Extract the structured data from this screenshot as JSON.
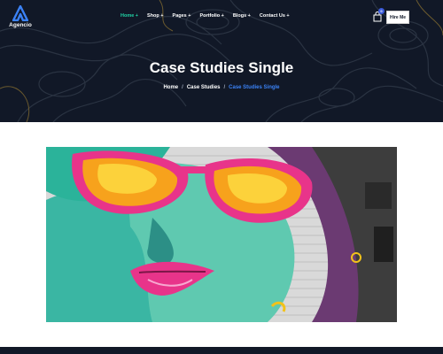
{
  "brand": {
    "name": "Agencio"
  },
  "nav": {
    "items": [
      {
        "label": "Home +"
      },
      {
        "label": "Shop +"
      },
      {
        "label": "Pages +"
      },
      {
        "label": "Portfolio +"
      },
      {
        "label": "Blogs +"
      },
      {
        "label": "Contact Us +"
      }
    ],
    "cart_count": "0",
    "hire_label": "Hire Me"
  },
  "hero": {
    "title": "Case Studies Single",
    "breadcrumb": [
      "Home",
      "Case Studies",
      "Case Studies Single"
    ]
  },
  "colors": {
    "hero_bg": "#111827",
    "accent_green": "#21d2a4",
    "accent_blue": "#3b82f6"
  }
}
